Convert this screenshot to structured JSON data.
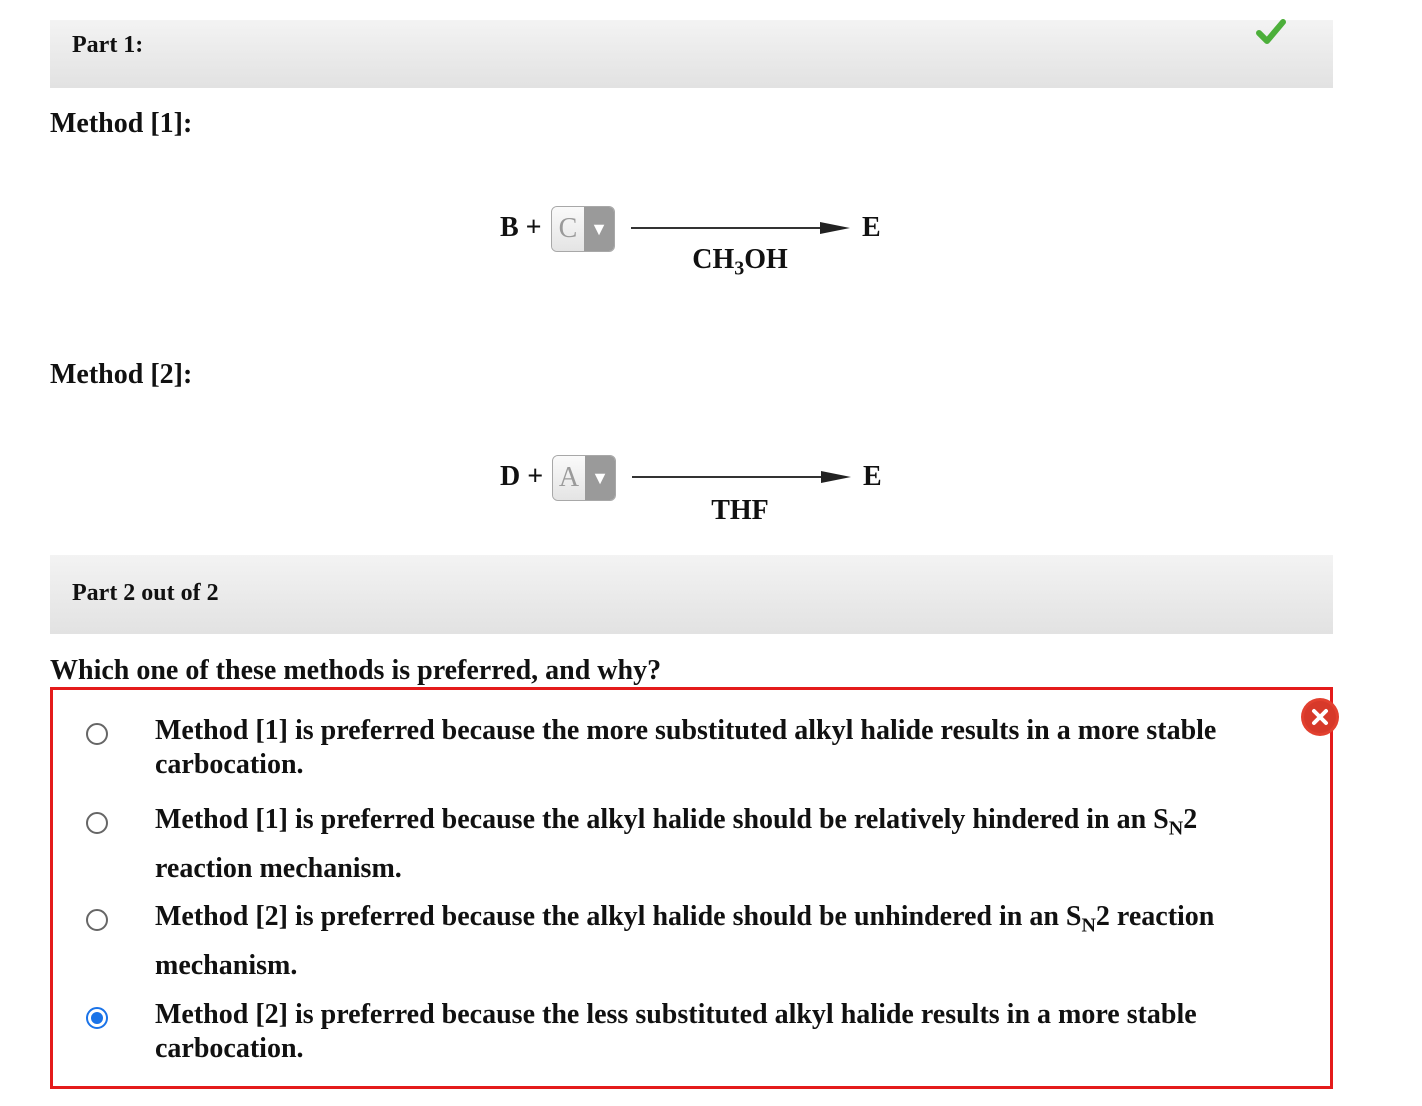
{
  "part1": {
    "title": "Part 1:"
  },
  "method1": {
    "label": "Method [1]:",
    "reactant": "B +",
    "select_value": "C",
    "product": "E",
    "reagent_pre": "CH",
    "reagent_sub": "3",
    "reagent_post": "OH"
  },
  "method2": {
    "label": "Method [2]:",
    "reactant": "D +",
    "select_value": "A",
    "product": "E",
    "reagent": "THF"
  },
  "part2": {
    "title": "Part 2 out of 2"
  },
  "question": "Which one of these methods is preferred, and why?",
  "options": [
    {
      "text": "Method [1] is preferred because the more substituted alkyl halide results in a more stable carbocation.",
      "selected": false
    },
    {
      "pre": "Method [1] is preferred because the alkyl halide should be relatively hindered in an S",
      "sub": "N",
      "post": "2 reaction mechanism.",
      "selected": false
    },
    {
      "pre": "Method [2] is preferred because the alkyl halide should be unhindered in an S",
      "sub": "N",
      "post": "2 reaction mechanism.",
      "selected": false
    },
    {
      "text": "Method [2] is preferred because the less substituted alkyl halide results in a more stable carbocation.",
      "selected": true
    }
  ],
  "colors": {
    "correct": "#4caf3a",
    "incorrect": "#e41b1b",
    "selected_radio": "#1a73e8"
  }
}
